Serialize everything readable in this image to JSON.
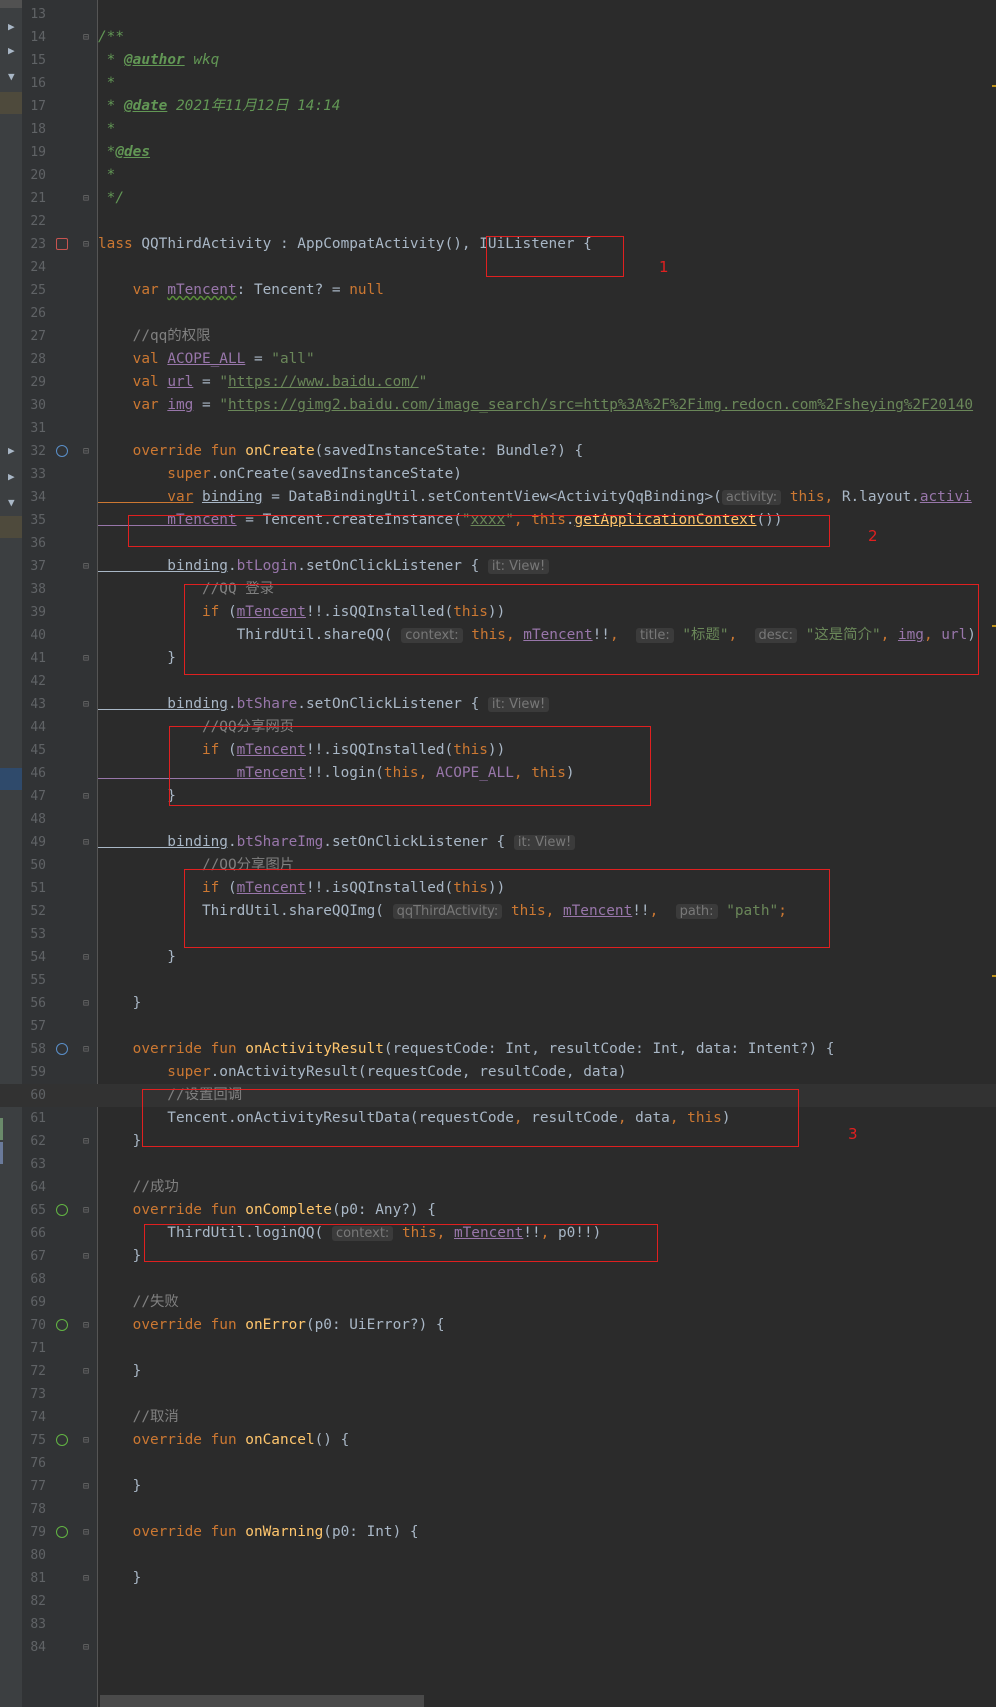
{
  "annotations": [
    "1",
    "2",
    "3"
  ],
  "lines": [
    {
      "n": "13",
      "parts": []
    },
    {
      "n": "14",
      "parts": [
        [
          "dcm",
          "/**"
        ]
      ]
    },
    {
      "n": "15",
      "parts": [
        [
          "dcm",
          " * "
        ],
        [
          "dtag",
          "@author"
        ],
        [
          "dcm",
          " wkq"
        ]
      ]
    },
    {
      "n": "16",
      "parts": [
        [
          "dcm",
          " *"
        ]
      ]
    },
    {
      "n": "17",
      "parts": [
        [
          "dcm",
          " * "
        ],
        [
          "dtag",
          "@date"
        ],
        [
          "dcm",
          " 2021年11月12日 14:14"
        ]
      ]
    },
    {
      "n": "18",
      "parts": [
        [
          "dcm",
          " *"
        ]
      ]
    },
    {
      "n": "19",
      "parts": [
        [
          "dcm",
          " *"
        ],
        [
          "dtag",
          "@des"
        ]
      ]
    },
    {
      "n": "20",
      "parts": [
        [
          "dcm",
          " *"
        ]
      ]
    },
    {
      "n": "21",
      "parts": [
        [
          "dcm",
          " */"
        ]
      ]
    },
    {
      "n": "22",
      "parts": []
    },
    {
      "n": "23",
      "parts": [
        [
          "kw",
          "lass "
        ],
        [
          "",
          "QQThirdActivity : AppCompatActivity(), IUiListener {"
        ]
      ]
    },
    {
      "n": "24",
      "parts": []
    },
    {
      "n": "25",
      "parts": [
        [
          "kw",
          "    var "
        ],
        [
          "prop wavy",
          "mTencent"
        ],
        [
          "",
          ": Tencent? = "
        ],
        [
          "kw",
          "null"
        ]
      ]
    },
    {
      "n": "26",
      "parts": []
    },
    {
      "n": "27",
      "parts": [
        [
          "cm",
          "    //qq的权限"
        ]
      ]
    },
    {
      "n": "28",
      "parts": [
        [
          "kw",
          "    val "
        ],
        [
          "prop ul",
          "ACOPE_ALL"
        ],
        [
          "",
          " = "
        ],
        [
          "str",
          "\"all\""
        ]
      ]
    },
    {
      "n": "29",
      "parts": [
        [
          "kw",
          "    val "
        ],
        [
          "prop ul",
          "url"
        ],
        [
          "",
          " = "
        ],
        [
          "str",
          "\""
        ],
        [
          "str ul",
          "https://www.baidu.com/"
        ],
        [
          "str",
          "\""
        ]
      ]
    },
    {
      "n": "30",
      "parts": [
        [
          "kw",
          "    var "
        ],
        [
          "prop ul",
          "img"
        ],
        [
          "",
          " = "
        ],
        [
          "str",
          "\""
        ],
        [
          "str ul",
          "https://gimg2.baidu.com/image_search/src=http%3A%2F%2Fimg.redocn.com%2Fsheying%2F20140"
        ]
      ]
    },
    {
      "n": "31",
      "parts": []
    },
    {
      "n": "32",
      "parts": [
        [
          "kw",
          "    override fun "
        ],
        [
          "fn",
          "onCreate"
        ],
        [
          "",
          "(savedInstanceState: Bundle?) {"
        ]
      ]
    },
    {
      "n": "33",
      "parts": [
        [
          "kw",
          "        super"
        ],
        [
          "",
          ".onCreate(savedInstanceState)"
        ]
      ]
    },
    {
      "n": "34",
      "parts": [
        [
          "kw ul",
          "        var"
        ],
        [
          "",
          " "
        ],
        [
          "ul",
          "binding"
        ],
        [
          "",
          " = DataBindingUtil.setContentView<ActivityQqBinding>("
        ],
        [
          "hint",
          "activity:"
        ],
        [
          "kw",
          " this"
        ],
        [
          "kw",
          ", "
        ],
        [
          "",
          "R.layout."
        ],
        [
          "prop ul",
          "activi"
        ]
      ]
    },
    {
      "n": "35",
      "parts": [
        [
          "prop ul",
          "        mTencent"
        ],
        [
          "",
          " = Tencent.createInstance("
        ],
        [
          "str",
          "\""
        ],
        [
          "str ul",
          "xxxx"
        ],
        [
          "str",
          "\""
        ],
        [
          "kw",
          ", this"
        ],
        [
          "",
          "."
        ],
        [
          "fn ul",
          "getApplicationContext"
        ],
        [
          "",
          "())"
        ]
      ]
    },
    {
      "n": "36",
      "parts": []
    },
    {
      "n": "37",
      "parts": [
        [
          "ul",
          "        binding"
        ],
        [
          "",
          "."
        ],
        [
          "prop",
          "btLogin"
        ],
        [
          "",
          ".setOnClickListener { "
        ],
        [
          "hint",
          "it: View!"
        ]
      ]
    },
    {
      "n": "38",
      "parts": [
        [
          "cm",
          "            //QQ 登录"
        ]
      ]
    },
    {
      "n": "39",
      "parts": [
        [
          "kw",
          "            if "
        ],
        [
          "",
          "("
        ],
        [
          "prop ul",
          "mTencent"
        ],
        [
          "",
          "!!.isQQInstalled("
        ],
        [
          "kw",
          "this"
        ],
        [
          "",
          "))"
        ]
      ]
    },
    {
      "n": "40",
      "parts": [
        [
          "",
          "                ThirdUtil.shareQQ( "
        ],
        [
          "hint",
          "context:"
        ],
        [
          "kw",
          " this, "
        ],
        [
          "prop ul",
          "mTencent"
        ],
        [
          "",
          "!!"
        ],
        [
          "kw",
          ",  "
        ],
        [
          "hint",
          "title:"
        ],
        [
          "str",
          " \"标题\""
        ],
        [
          "kw",
          ",  "
        ],
        [
          "hint",
          "desc:"
        ],
        [
          "str",
          " \"这是简介\""
        ],
        [
          "kw",
          ", "
        ],
        [
          "prop ul",
          "img"
        ],
        [
          "kw",
          ", "
        ],
        [
          "prop",
          "url"
        ],
        [
          "",
          ")"
        ]
      ]
    },
    {
      "n": "41",
      "parts": [
        [
          "",
          "        }"
        ]
      ]
    },
    {
      "n": "42",
      "parts": []
    },
    {
      "n": "43",
      "parts": [
        [
          "ul",
          "        binding"
        ],
        [
          "",
          "."
        ],
        [
          "prop",
          "btShare"
        ],
        [
          "",
          ".setOnClickListener { "
        ],
        [
          "hint",
          "it: View!"
        ]
      ]
    },
    {
      "n": "44",
      "parts": [
        [
          "cm",
          "            //QQ分享网页"
        ]
      ]
    },
    {
      "n": "45",
      "parts": [
        [
          "kw",
          "            if "
        ],
        [
          "",
          "("
        ],
        [
          "prop ul",
          "mTencent"
        ],
        [
          "",
          "!!.isQQInstalled("
        ],
        [
          "kw",
          "this"
        ],
        [
          "",
          "))"
        ]
      ]
    },
    {
      "n": "46",
      "parts": [
        [
          "prop ul",
          "                mTencent"
        ],
        [
          "",
          "!!.login("
        ],
        [
          "kw",
          "this"
        ],
        [
          "kw",
          ", "
        ],
        [
          "prop",
          "ACOPE_ALL"
        ],
        [
          "kw",
          ", this"
        ],
        [
          "",
          ")"
        ]
      ]
    },
    {
      "n": "47",
      "parts": [
        [
          "",
          "        }"
        ]
      ]
    },
    {
      "n": "48",
      "parts": []
    },
    {
      "n": "49",
      "parts": [
        [
          "ul",
          "        binding"
        ],
        [
          "",
          "."
        ],
        [
          "prop",
          "btShareImg"
        ],
        [
          "",
          ".setOnClickListener { "
        ],
        [
          "hint",
          "it: View!"
        ]
      ]
    },
    {
      "n": "50",
      "parts": [
        [
          "cm",
          "            //QQ分享图片"
        ]
      ]
    },
    {
      "n": "51",
      "parts": [
        [
          "kw",
          "            if "
        ],
        [
          "",
          "("
        ],
        [
          "prop ul",
          "mTencent"
        ],
        [
          "",
          "!!.isQQInstalled("
        ],
        [
          "kw",
          "this"
        ],
        [
          "",
          "))"
        ]
      ]
    },
    {
      "n": "52",
      "parts": [
        [
          "",
          "            ThirdUtil.shareQQImg( "
        ],
        [
          "hint",
          "qqThirdActivity:"
        ],
        [
          "kw",
          " this, "
        ],
        [
          "prop ul",
          "mTencent"
        ],
        [
          "",
          "!!"
        ],
        [
          "kw",
          ",  "
        ],
        [
          "hint",
          "path:"
        ],
        [
          "str",
          " \"path\""
        ],
        [
          "kw",
          ";"
        ]
      ]
    },
    {
      "n": "53",
      "parts": []
    },
    {
      "n": "54",
      "parts": [
        [
          "",
          "        }"
        ]
      ]
    },
    {
      "n": "55",
      "parts": []
    },
    {
      "n": "56",
      "parts": [
        [
          "",
          "    }"
        ]
      ]
    },
    {
      "n": "57",
      "parts": []
    },
    {
      "n": "58",
      "parts": [
        [
          "kw",
          "    override fun "
        ],
        [
          "fn",
          "onActivityResult"
        ],
        [
          "",
          "(requestCode: Int, resultCode: Int, data: Intent?) {"
        ]
      ]
    },
    {
      "n": "59",
      "parts": [
        [
          "kw",
          "        super"
        ],
        [
          "",
          ".onActivityResult(requestCode, resultCode, data)"
        ]
      ]
    },
    {
      "n": "60",
      "parts": [
        [
          "cm",
          "        //设置回调"
        ]
      ]
    },
    {
      "n": "61",
      "parts": [
        [
          "",
          "        Tencent.onActivityResultData(requestCode"
        ],
        [
          "kw",
          ", "
        ],
        [
          "",
          "resultCode"
        ],
        [
          "kw",
          ", "
        ],
        [
          "",
          "data"
        ],
        [
          "kw",
          ", this"
        ],
        [
          "",
          ")"
        ]
      ]
    },
    {
      "n": "62",
      "parts": [
        [
          "",
          "    }"
        ]
      ]
    },
    {
      "n": "63",
      "parts": []
    },
    {
      "n": "64",
      "parts": [
        [
          "cm",
          "    //成功"
        ]
      ]
    },
    {
      "n": "65",
      "parts": [
        [
          "kw",
          "    override fun "
        ],
        [
          "fn",
          "onComplete"
        ],
        [
          "",
          "(p0: Any?) {"
        ]
      ]
    },
    {
      "n": "66",
      "parts": [
        [
          "",
          "        ThirdUtil.loginQQ( "
        ],
        [
          "hint",
          "context:"
        ],
        [
          "kw",
          " this, "
        ],
        [
          "prop ul",
          "mTencent"
        ],
        [
          "",
          "!!"
        ],
        [
          "kw",
          ", "
        ],
        [
          "",
          "p0!!)"
        ]
      ]
    },
    {
      "n": "67",
      "parts": [
        [
          "",
          "    }"
        ]
      ]
    },
    {
      "n": "68",
      "parts": []
    },
    {
      "n": "69",
      "parts": [
        [
          "cm",
          "    //失败"
        ]
      ]
    },
    {
      "n": "70",
      "parts": [
        [
          "kw",
          "    override fun "
        ],
        [
          "fn",
          "onError"
        ],
        [
          "",
          "(p0: UiError?) {"
        ]
      ]
    },
    {
      "n": "71",
      "parts": []
    },
    {
      "n": "72",
      "parts": [
        [
          "",
          "    }"
        ]
      ]
    },
    {
      "n": "73",
      "parts": []
    },
    {
      "n": "74",
      "parts": [
        [
          "cm",
          "    //取消"
        ]
      ]
    },
    {
      "n": "75",
      "parts": [
        [
          "kw",
          "    override fun "
        ],
        [
          "fn",
          "onCancel"
        ],
        [
          "",
          "() {"
        ]
      ]
    },
    {
      "n": "76",
      "parts": []
    },
    {
      "n": "77",
      "parts": [
        [
          "",
          "    }"
        ]
      ]
    },
    {
      "n": "78",
      "parts": []
    },
    {
      "n": "79",
      "parts": [
        [
          "kw",
          "    override fun "
        ],
        [
          "fn",
          "onWarning"
        ],
        [
          "",
          "(p0: Int) {"
        ]
      ]
    },
    {
      "n": "80",
      "parts": []
    },
    {
      "n": "81",
      "parts": [
        [
          "",
          "    }"
        ]
      ]
    },
    {
      "n": "82",
      "parts": []
    },
    {
      "n": "83",
      "parts": []
    },
    {
      "n": "84",
      "parts": []
    }
  ]
}
